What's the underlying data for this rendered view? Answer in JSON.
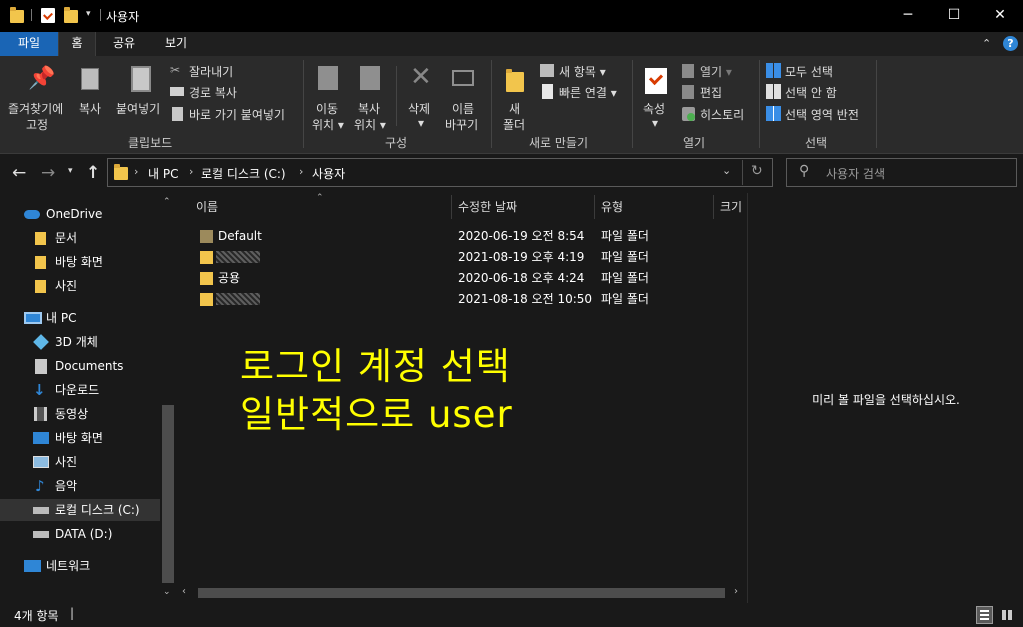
{
  "window": {
    "title": "사용자",
    "minimize_icon": "minimize-icon",
    "maximize_icon": "maximize-icon",
    "close_icon": "close-icon"
  },
  "tabs": [
    "파일",
    "홈",
    "공유",
    "보기"
  ],
  "ribbon": {
    "clipboard": {
      "pin_line1": "즐겨찾기에",
      "pin_line2": "고정",
      "copy": "복사",
      "paste": "붙여넣기",
      "cut": "잘라내기",
      "copy_path": "경로 복사",
      "paste_shortcut": "바로 가기 붙여넣기",
      "group": "클립보드"
    },
    "organize": {
      "move_line1": "이동",
      "move_line2": "위치",
      "copy_line1": "복사",
      "copy_line2": "위치",
      "delete": "삭제",
      "rename_line1": "이름",
      "rename_line2": "바꾸기",
      "group": "구성"
    },
    "new": {
      "new_line1": "새",
      "new_line2": "폴더",
      "new_item": "새 항목",
      "easy_access": "빠른 연결",
      "group": "새로 만들기"
    },
    "open": {
      "properties": "속성",
      "open": "열기",
      "edit": "편집",
      "history": "히스토리",
      "group": "열기"
    },
    "select": {
      "select_all": "모두 선택",
      "select_none": "선택 안 함",
      "invert": "선택 영역 반전",
      "group": "선택"
    }
  },
  "address": {
    "crumbs": [
      "내 PC",
      "로컬 디스크 (C:)",
      "사용자"
    ],
    "search_placeholder": "사용자 검색"
  },
  "sidebar": [
    {
      "label": "OneDrive"
    },
    {
      "label": "문서"
    },
    {
      "label": "바탕 화면"
    },
    {
      "label": "사진"
    },
    {
      "label": "내 PC"
    },
    {
      "label": "3D 개체"
    },
    {
      "label": "Documents"
    },
    {
      "label": "다운로드"
    },
    {
      "label": "동영상"
    },
    {
      "label": "바탕 화면"
    },
    {
      "label": "사진"
    },
    {
      "label": "음악"
    },
    {
      "label": "로컬 디스크 (C:)"
    },
    {
      "label": "DATA (D:)"
    },
    {
      "label": "네트워크"
    }
  ],
  "columns": [
    "이름",
    "수정한 날짜",
    "유형",
    "크기"
  ],
  "files": [
    {
      "name": "Default",
      "date": "2020-06-19 오전 8:54",
      "type": "파일 폴더"
    },
    {
      "name": "",
      "date": "2021-08-19 오후 4:19",
      "type": "파일 폴더"
    },
    {
      "name": "공용",
      "date": "2020-06-18 오후 4:24",
      "type": "파일 폴더"
    },
    {
      "name": "",
      "date": "2021-08-18 오전 10:50",
      "type": "파일 폴더"
    }
  ],
  "preview": {
    "message": "미리 볼 파일을 선택하십시오."
  },
  "status": {
    "count": "4개 항목"
  },
  "annotation": {
    "line1": "로그인 계정 선택",
    "line2": "일반적으로 user",
    "color": "#ffff00"
  },
  "colors": {
    "file_tab": "#1a65b5",
    "folder": "#f2c54c",
    "accent_blue": "#2f86d6"
  }
}
